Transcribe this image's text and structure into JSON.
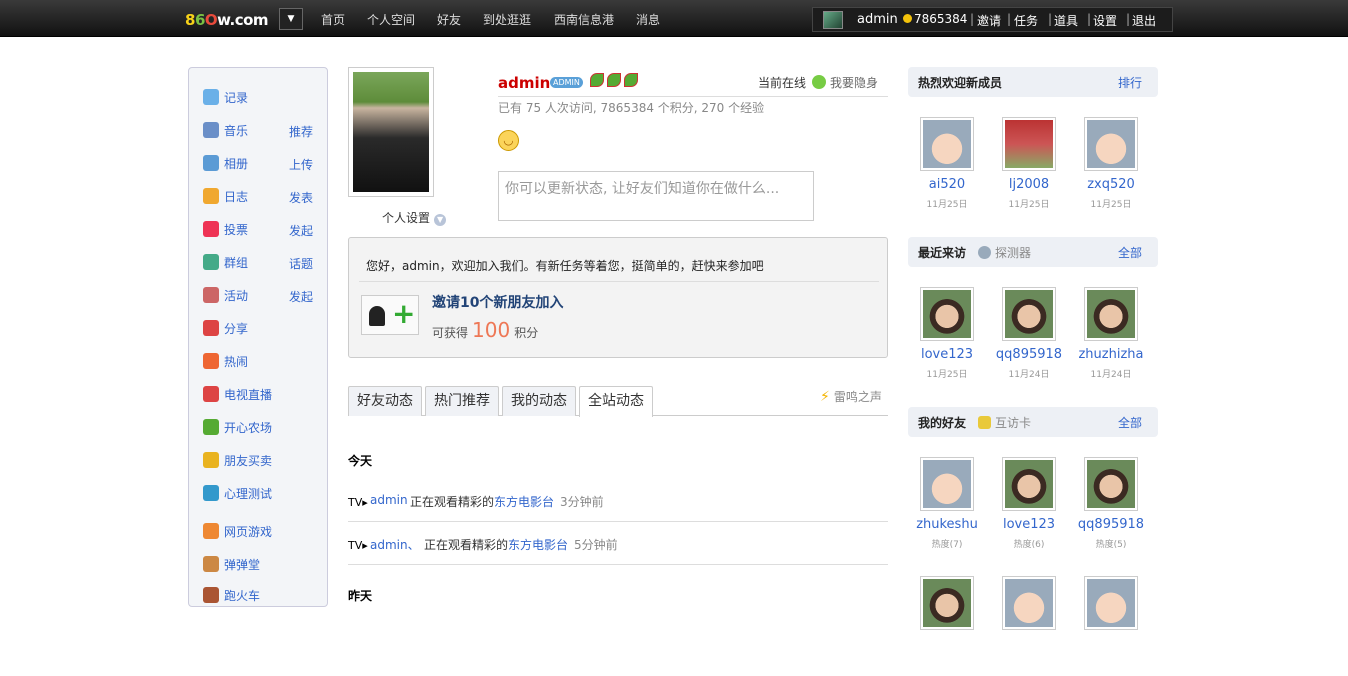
{
  "header": {
    "logo": "86Ow.com",
    "nav": [
      "首页",
      "个人空间",
      "好友",
      "到处逛逛",
      "西南信息港",
      "消息"
    ],
    "user": {
      "name": "admin",
      "credits": "7865384",
      "links": [
        "邀请",
        "任务",
        "道具",
        "设置",
        "退出"
      ],
      "separator": "|"
    }
  },
  "sidebar": {
    "items": [
      {
        "label": "记录",
        "action": "",
        "icon": "speech-bubble-icon",
        "color": "#6ab0e8"
      },
      {
        "label": "音乐",
        "action": "推荐",
        "icon": "headphones-icon",
        "color": "#6a8fc8"
      },
      {
        "label": "相册",
        "action": "上传",
        "icon": "photo-album-icon",
        "color": "#5b9bd5"
      },
      {
        "label": "日志",
        "action": "发表",
        "icon": "journal-icon",
        "color": "#f0a830"
      },
      {
        "label": "投票",
        "action": "发起",
        "icon": "bar-chart-icon",
        "color": "#e35"
      },
      {
        "label": "群组",
        "action": "话题",
        "icon": "group-icon",
        "color": "#4a8"
      },
      {
        "label": "活动",
        "action": "发起",
        "icon": "calendar-icon",
        "color": "#c66"
      },
      {
        "label": "分享",
        "action": "",
        "icon": "heart-share-icon",
        "color": "#d44"
      },
      {
        "label": "热闹",
        "action": "",
        "icon": "fire-icon",
        "color": "#e63"
      },
      {
        "label": "电视直播",
        "action": "",
        "icon": "heart-tv-icon",
        "color": "#d44"
      },
      {
        "label": "开心农场",
        "action": "",
        "icon": "sprout-icon",
        "color": "#5a3"
      },
      {
        "label": "朋友买卖",
        "action": "",
        "icon": "coins-icon",
        "color": "#e9b320"
      },
      {
        "label": "心理测试",
        "action": "",
        "icon": "flask-icon",
        "color": "#39c"
      },
      {
        "label": "网页游戏",
        "action": "",
        "icon": "game-icon",
        "color": "#e83"
      },
      {
        "label": "弹弹堂",
        "action": "",
        "icon": "cartoon-face-icon",
        "color": "#c84"
      },
      {
        "label": "跑火车",
        "action": "",
        "icon": "train-icon",
        "color": "#a53"
      }
    ]
  },
  "profile": {
    "username": "admin",
    "badge": "ADMIN",
    "online_label": "当前在线",
    "hide_label": "我要隐身",
    "stats": "已有  75 人次访问, 7865384 个积分, 270 个经验",
    "settings_label": "个人设置",
    "status_placeholder": "你可以更新状态, 让好友们知道你在做什么..."
  },
  "task": {
    "message": "您好，admin，欢迎加入我们。有新任务等着您，挺简单的，赶快来参加吧",
    "title": "邀请10个新朋友加入",
    "reward_prefix": "可获得",
    "reward_points": "100",
    "reward_suffix": "积分"
  },
  "feed": {
    "tabs": [
      "好友动态",
      "热门推荐",
      "我的动态",
      "全站动态"
    ],
    "active_tab": 3,
    "thunder_label": "雷鸣之声",
    "today": "今天",
    "yesterday": "昨天",
    "items": [
      {
        "tv": "TV▸",
        "user": "admin",
        "text": "正在观看精彩的",
        "link": "东方电影台",
        "time": "3分钟前"
      },
      {
        "tv": "TV▸",
        "user": "admin、",
        "text": "正在观看精彩的",
        "link": "东方电影台",
        "time": "5分钟前"
      }
    ]
  },
  "right": {
    "new_members": {
      "title": "热烈欢迎新成员",
      "link": "排行",
      "members": [
        {
          "name": "ai520",
          "date": "11月25日",
          "face": "boy"
        },
        {
          "name": "lj2008",
          "date": "11月25日",
          "face": "kid"
        },
        {
          "name": "zxq520",
          "date": "11月25日",
          "face": "boy"
        }
      ]
    },
    "visitors": {
      "title": "最近来访",
      "sub": "探测器",
      "link": "全部",
      "members": [
        {
          "name": "love123",
          "date": "11月25日",
          "face": "girl"
        },
        {
          "name": "qq895918",
          "date": "11月24日",
          "face": "girl"
        },
        {
          "name": "zhuzhizha",
          "date": "11月24日",
          "face": "girl"
        }
      ]
    },
    "friends": {
      "title": "我的好友",
      "sub": "互访卡",
      "link": "全部",
      "members": [
        {
          "name": "zhukeshu",
          "date": "热度(7)",
          "face": "boy"
        },
        {
          "name": "love123",
          "date": "热度(6)",
          "face": "girl"
        },
        {
          "name": "qq895918",
          "date": "热度(5)",
          "face": "girl"
        }
      ]
    }
  }
}
